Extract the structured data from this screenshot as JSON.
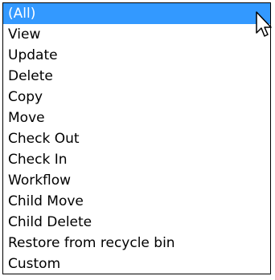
{
  "listbox": {
    "options": [
      "(All)",
      "View",
      "Update",
      "Delete",
      "Copy",
      "Move",
      "Check Out",
      "Check In",
      "Workflow",
      "Child Move",
      "Child Delete",
      "Restore from recycle bin",
      "Custom"
    ],
    "selected_index": 0,
    "selected_value": "(All)",
    "selection_color": "#3399ff"
  },
  "cursor": {
    "icon": "arrow-pointer-icon"
  }
}
